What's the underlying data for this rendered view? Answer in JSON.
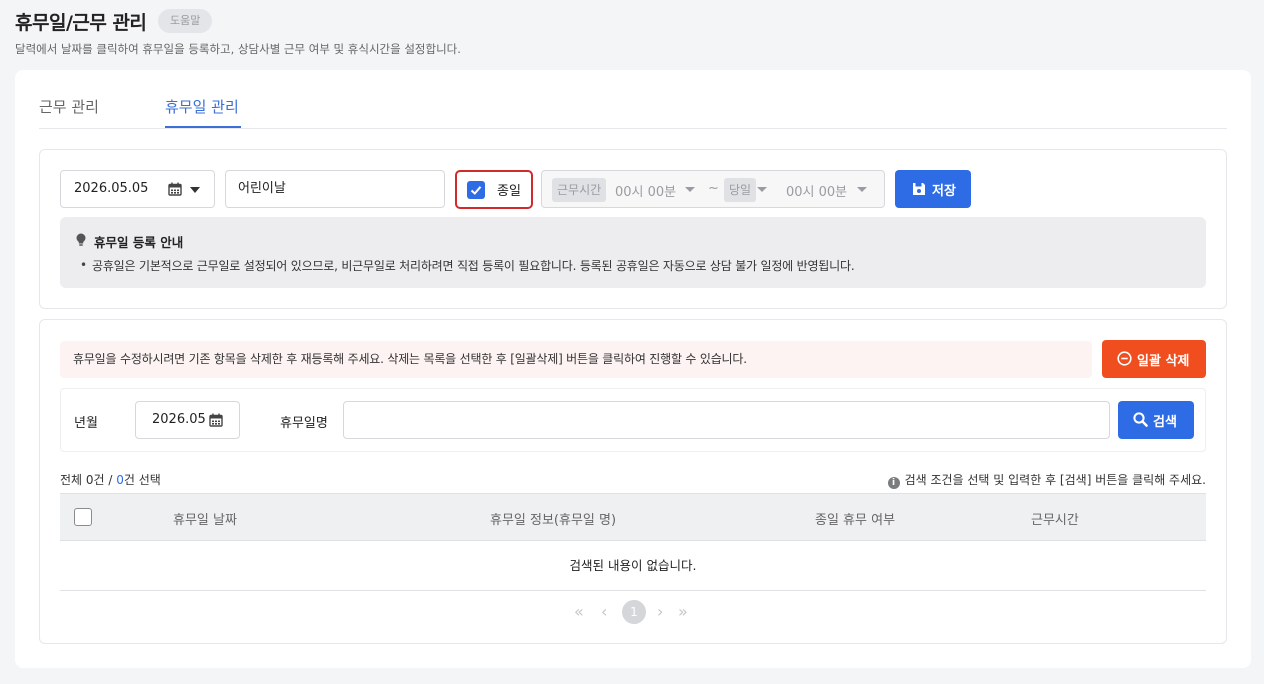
{
  "page": {
    "title": "휴무일/근무 관리",
    "help_label": "도움말",
    "description": "달력에서 날짜를 클릭하여 휴무일을 등록하고, 상담사별 근무 여부 및 휴식시간을 설정합니다."
  },
  "tabs": [
    {
      "label": "근무 관리",
      "active": false
    },
    {
      "label": "휴무일 관리",
      "active": true
    }
  ],
  "registration": {
    "date_value": "2026.05.05",
    "name_value": "어린이날",
    "allday_label": "종일",
    "allday_checked": true,
    "work_time_tag": "근무시간",
    "start_time": "00시 00분",
    "tilde": "~",
    "day_tag": "당일",
    "end_time": "00시 00분",
    "save_label": "저장"
  },
  "guide": {
    "title": "휴무일 등록 안내",
    "bullet": "•",
    "text": "공휴일은 기본적으로 근무일로 설정되어 있으므로, 비근무일로 처리하려면 직접 등록이 필요합니다. 등록된 공휴일은 자동으로 상담 불가 일정에 반영됩니다."
  },
  "list": {
    "notice": "휴무일을 수정하시려면 기존 항목을 삭제한 후 재등록해 주세요. 삭제는 목록을 선택한 후 [일괄삭제] 버튼을 클릭하여 진행할 수 있습니다.",
    "bulk_delete_label": "일괄 삭제",
    "search": {
      "month_label": "년월",
      "month_value": "2026.05",
      "name_label": "휴무일명",
      "name_value": "",
      "search_label": "검색"
    },
    "count_prefix": "전체 ",
    "total": "0",
    "count_mid": "건 / ",
    "selected": "0",
    "count_suffix": "건 선택",
    "hint_icon": "i",
    "hint": "검색 조건을 선택 및 입력한 후 [검색] 버튼을 클릭해 주세요.",
    "columns": [
      "휴무일 날짜",
      "휴무일 정보(휴무일 명)",
      "종일 휴무 여부",
      "근무시간"
    ],
    "empty_text": "검색된 내용이 없습니다.",
    "pagination": {
      "current": "1"
    }
  },
  "colors": {
    "primary": "#2e6ce6",
    "danger": "#f04e1f",
    "highlight_border": "#d12a2a"
  }
}
